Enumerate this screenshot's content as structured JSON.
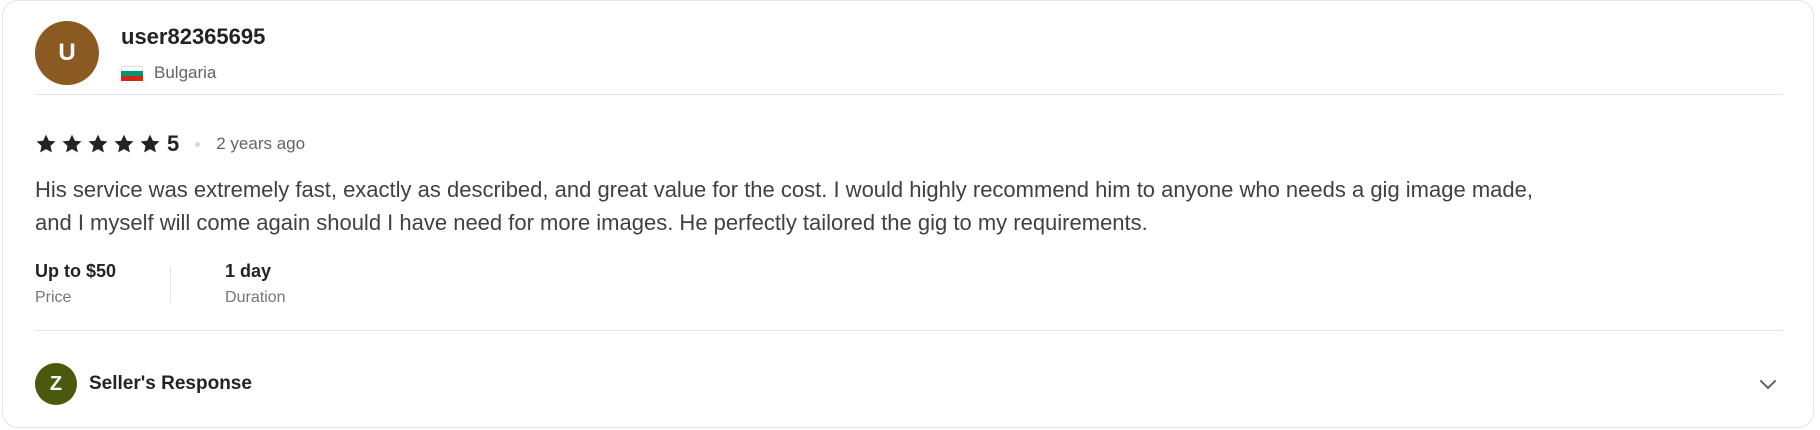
{
  "reviewer": {
    "avatar_letter": "U",
    "avatar_color": "#8b5a23",
    "username": "user82365695",
    "flag_icon": "bulgaria-flag-icon",
    "country": "Bulgaria"
  },
  "rating": {
    "stars": 5,
    "star_icon": "star-icon",
    "value": "5",
    "time_ago": "2 years ago"
  },
  "review": {
    "text": "His service was extremely fast, exactly as described, and great value for the cost. I would highly recommend him to anyone who needs a gig image made, and I myself will come again should I have need for more images. He perfectly tailored the gig to my requirements."
  },
  "meta": {
    "price_value": "Up to $50",
    "price_label": "Price",
    "duration_value": "1 day",
    "duration_label": "Duration"
  },
  "seller_response": {
    "avatar_letter": "Z",
    "avatar_color": "#4a5a0d",
    "title": "Seller's Response",
    "toggle_icon": "chevron-down-icon"
  }
}
